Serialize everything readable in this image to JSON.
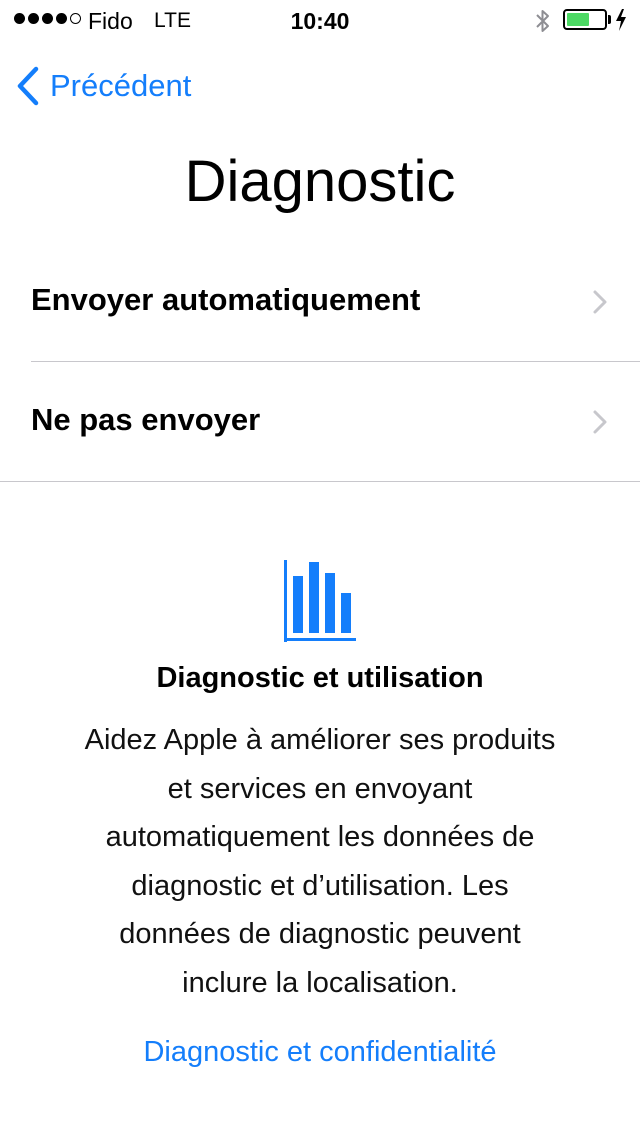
{
  "status_bar": {
    "carrier": "Fido",
    "network": "LTE",
    "time": "10:40",
    "signal_bars_filled": 4,
    "signal_bars_total": 5,
    "battery_level": 0.6,
    "battery_color": "#4cd964"
  },
  "nav": {
    "back_label": "Précédent",
    "accent": "#147efb"
  },
  "page": {
    "title": "Diagnostic"
  },
  "options": [
    {
      "label": "Envoyer automatiquement"
    },
    {
      "label": "Ne pas envoyer"
    }
  ],
  "info": {
    "icon": "bar-chart-icon",
    "heading": "Diagnostic et utilisation",
    "lines": [
      "Aidez Apple à améliorer ses produits",
      "et services en envoyant",
      "automatiquement les données de",
      "diagnostic et d’utilisation. Les",
      "données de diagnostic peuvent",
      "inclure la localisation."
    ],
    "link": "Diagnostic et confidentialité"
  }
}
